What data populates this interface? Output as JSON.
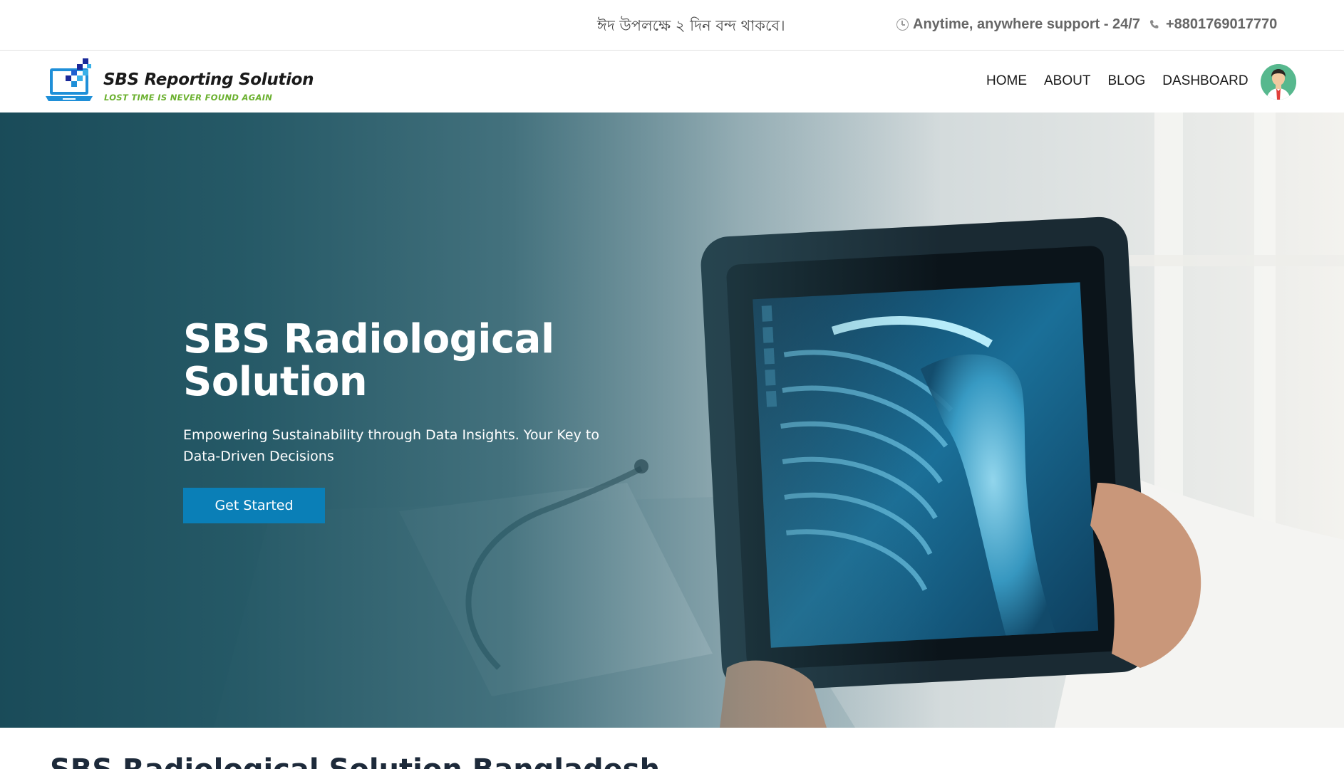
{
  "topbar": {
    "notice": "ঈদ উপলক্ষে ২ দিন বন্দ থাকবে।",
    "support_text": "Anytime, anywhere support - 24/7",
    "phone": "+8801769017770"
  },
  "brand": {
    "title": "SBS Reporting Solution",
    "tagline": "LOST TIME IS NEVER FOUND AGAIN"
  },
  "nav": {
    "items": [
      {
        "label": "HOME"
      },
      {
        "label": "ABOUT"
      },
      {
        "label": "BLOG"
      },
      {
        "label": "DASHBOARD"
      }
    ]
  },
  "hero": {
    "title": "SBS Radiological Solution",
    "subtitle": "Empowering Sustainability through Data Insights. Your Key to Data-Driven Decisions",
    "cta_label": "Get Started",
    "cta_color": "#0a7fb7",
    "overlay_color": "#164856"
  },
  "next_section": {
    "heading": "SBS Radiological Solution Bangladesh"
  }
}
